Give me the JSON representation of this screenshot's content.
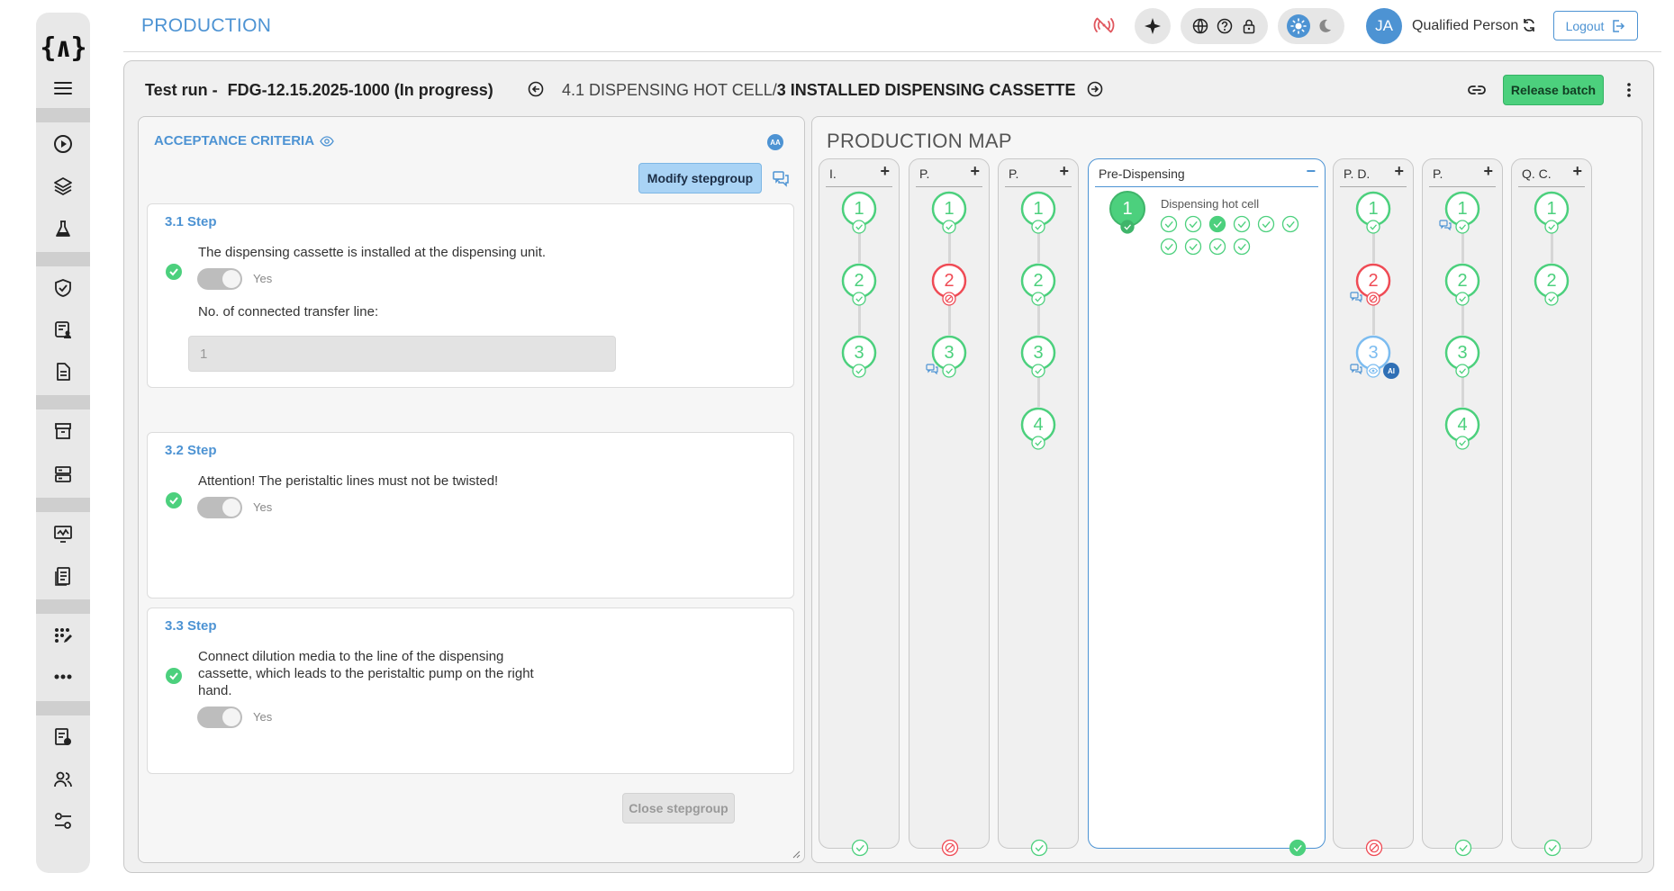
{
  "app": {
    "title": "PRODUCTION",
    "logo": "{∧}"
  },
  "sidebar": {
    "items": [
      {
        "icon": "menu-icon"
      },
      {
        "icon": "play-circle-icon"
      },
      {
        "icon": "layers-icon"
      },
      {
        "icon": "flask-icon"
      },
      {
        "icon": "shield-check-icon"
      },
      {
        "icon": "user-document-icon"
      },
      {
        "icon": "document-icon"
      },
      {
        "icon": "archive-icon"
      },
      {
        "icon": "server-icon"
      },
      {
        "icon": "monitor-chart-icon"
      },
      {
        "icon": "clipboard-icon"
      },
      {
        "icon": "grid-edit-icon"
      },
      {
        "icon": "more-dots-icon"
      },
      {
        "icon": "list-settings-icon"
      },
      {
        "icon": "users-icon"
      },
      {
        "icon": "sliders-icon"
      }
    ]
  },
  "header": {
    "user_initials": "JA",
    "user_role": "Qualified Person",
    "logout_label": "Logout",
    "theme_active": "light"
  },
  "run": {
    "prefix": "Test run - ",
    "batch": "FDG-12.15.2025-1000 (In progress)",
    "crumb_parent": "4.1 DISPENSING HOT CELL/",
    "crumb_current": "3 INSTALLED DISPENSING CASSETTE",
    "release_label": "Release batch"
  },
  "acceptance": {
    "title": "ACCEPTANCE CRITERIA",
    "badge": "AA",
    "modify_label": "Modify stepgroup",
    "close_label": "Close stepgroup",
    "steps": [
      {
        "title": "3.1 Step",
        "text": "The dispensing cassette is installed at the dispensing unit.",
        "toggle_label": "Yes",
        "field_label": "No. of connected transfer line:",
        "field_value": "1"
      },
      {
        "title": "3.2 Step",
        "text": "Attention! The peristaltic lines must not be twisted!",
        "toggle_label": "Yes"
      },
      {
        "title": "3.3 Step",
        "text_line1": "Connect dilution media to the line of the dispensing",
        "text_line2": "cassette, which leads to the peristaltic pump on the right",
        "text_line3": "hand.",
        "toggle_label": "Yes"
      }
    ]
  },
  "map": {
    "title": "PRODUCTION MAP",
    "columns": [
      {
        "label": "I.",
        "status": "done",
        "nodes": [
          {
            "n": "1",
            "state": "done"
          },
          {
            "n": "2",
            "state": "done"
          },
          {
            "n": "3",
            "state": "done"
          }
        ]
      },
      {
        "label": "P.",
        "status": "error",
        "nodes": [
          {
            "n": "1",
            "state": "done"
          },
          {
            "n": "2",
            "state": "error"
          },
          {
            "n": "3",
            "state": "done",
            "chat": true
          }
        ]
      },
      {
        "label": "P.",
        "status": "done",
        "nodes": [
          {
            "n": "1",
            "state": "done"
          },
          {
            "n": "2",
            "state": "done"
          },
          {
            "n": "3",
            "state": "done"
          },
          {
            "n": "4",
            "state": "done"
          }
        ]
      },
      {
        "label": "Pre-Dispensing",
        "status": "done",
        "expanded": true,
        "group": {
          "n": "1",
          "title": "Dispensing hot cell",
          "substeps": 10,
          "active_index": 2
        }
      },
      {
        "label": "P. D.",
        "status": "error",
        "nodes": [
          {
            "n": "1",
            "state": "done"
          },
          {
            "n": "2",
            "state": "error",
            "chat": true
          },
          {
            "n": "3",
            "state": "current",
            "chat": true,
            "ai": "AI"
          }
        ]
      },
      {
        "label": "P.",
        "status": "done",
        "nodes": [
          {
            "n": "1",
            "state": "done",
            "chat": true
          },
          {
            "n": "2",
            "state": "done"
          },
          {
            "n": "3",
            "state": "done"
          },
          {
            "n": "4",
            "state": "done"
          }
        ]
      },
      {
        "label": "Q. C.",
        "status": "done",
        "nodes": [
          {
            "n": "1",
            "state": "done"
          },
          {
            "n": "2",
            "state": "done"
          }
        ]
      }
    ]
  },
  "colors": {
    "accent": "#4d93d3",
    "success": "#4cd07d",
    "error": "#ef4b55",
    "current": "#7cbcf0"
  }
}
